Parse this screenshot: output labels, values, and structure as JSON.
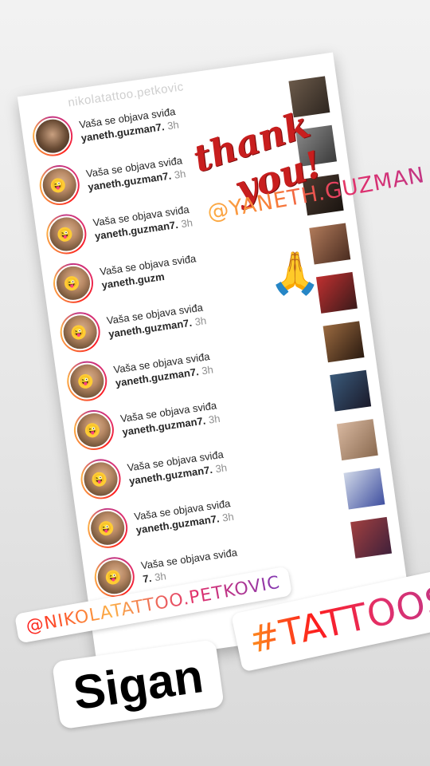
{
  "story": {
    "header_username": "nikolatattoo.petkovic",
    "notifications": [
      {
        "action": "Vaša se objava sviđa",
        "username": "yaneth.guzman7.",
        "time": "3h"
      },
      {
        "action": "Vaša se objava sviđa",
        "username": "yaneth.guzman7.",
        "time": "3h"
      },
      {
        "action": "Vaša se objava sviđa",
        "username": "yaneth.guzman7.",
        "time": "3h"
      },
      {
        "action": "Vaša se objava sviđa",
        "username": "yaneth.guzm",
        "time": ""
      },
      {
        "action": "Vaša se objava sviđa",
        "username": "yaneth.guzman7.",
        "time": "3h"
      },
      {
        "action": "Vaša se objava sviđa",
        "username": "yaneth.guzman7.",
        "time": "3h"
      },
      {
        "action": "Vaša se objava sviđa",
        "username": "yaneth.guzman7.",
        "time": "3h"
      },
      {
        "action": "Vaša se objava sviđa",
        "username": "yaneth.guzman7.",
        "time": "3h"
      },
      {
        "action": "Vaša se objava sviđa",
        "username": "yaneth.guzman7.",
        "time": "3h"
      },
      {
        "action": "Vaša se objava sviđa",
        "username": "7.",
        "time": "3h"
      }
    ],
    "thanks_line1": "thank",
    "thanks_line2": "you!",
    "mention_yaneth": "@YANETH.GUZMAN",
    "pray_emoji": "🙏",
    "mention_nikola": "@NIKOLATATTOO.PETKOVIC",
    "hashtag": "#TATTOOS",
    "name_sticker": "Sigan",
    "colors": {
      "instagram_gradient": [
        "#fd1d1d",
        "#fcaf45",
        "#e1306c",
        "#833ab4"
      ],
      "thanks_red": "#c81e1e"
    }
  }
}
